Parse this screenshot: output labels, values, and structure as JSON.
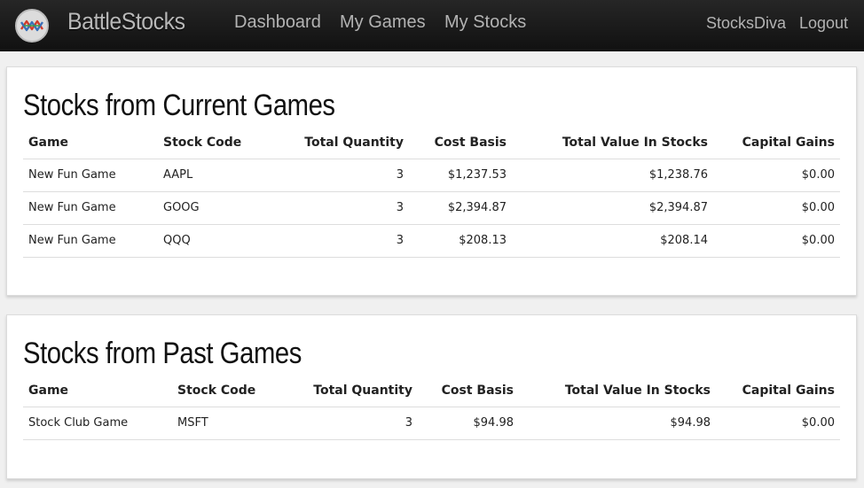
{
  "brand": {
    "name": "BattleStocks"
  },
  "nav": {
    "dashboard": "Dashboard",
    "my_games": "My Games",
    "my_stocks": "My Stocks",
    "user": "StocksDiva",
    "logout": "Logout"
  },
  "current": {
    "title": "Stocks from Current Games",
    "headers": [
      "Game",
      "Stock Code",
      "Total Quantity",
      "Cost Basis",
      "Total Value In Stocks",
      "Capital Gains"
    ],
    "rows": [
      [
        "New Fun Game",
        "AAPL",
        "3",
        "$1,237.53",
        "$1,238.76",
        "$0.00"
      ],
      [
        "New Fun Game",
        "GOOG",
        "3",
        "$2,394.87",
        "$2,394.87",
        "$0.00"
      ],
      [
        "New Fun Game",
        "QQQ",
        "3",
        "$208.13",
        "$208.14",
        "$0.00"
      ]
    ]
  },
  "past": {
    "title": "Stocks from Past Games",
    "headers": [
      "Game",
      "Stock Code",
      "Total Quantity",
      "Cost Basis",
      "Total Value In Stocks",
      "Capital Gains"
    ],
    "rows": [
      [
        "Stock Club Game",
        "MSFT",
        "3",
        "$94.98",
        "$94.98",
        "$0.00"
      ]
    ]
  }
}
